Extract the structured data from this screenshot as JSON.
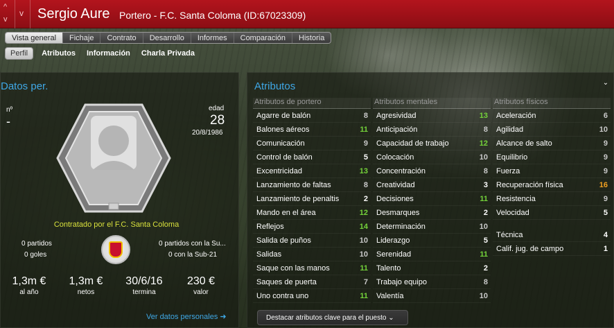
{
  "header": {
    "name": "Sergio Aure",
    "subtitle": "Portero - F.C. Santa Coloma (ID:67023309)",
    "up_icon": "^",
    "down_icon": "v",
    "dd_icon": "v"
  },
  "tabs": [
    "Vista general",
    "Fichaje",
    "Contrato",
    "Desarrollo",
    "Informes",
    "Comparación",
    "Historia"
  ],
  "subtabs": [
    "Perfil",
    "Atributos",
    "Información",
    "Charla Privada"
  ],
  "personal": {
    "title": "Datos per.",
    "num_label": "nº",
    "num_value": "-",
    "age_label": "edad",
    "age_value": "28",
    "dob": "20/8/1986",
    "contracted": "Contratado por el F.C. Santa Coloma",
    "partidos": "0 partidos",
    "goles": "0 goles",
    "sub_partidos": "0 partidos con la Su...",
    "sub_goles": "0 con la Sub-21",
    "money": [
      {
        "v": "1,3m €",
        "l": "al año"
      },
      {
        "v": "1,3m €",
        "l": "netos"
      },
      {
        "v": "30/6/16",
        "l": "termina"
      },
      {
        "v": "230 €",
        "l": "valor"
      }
    ],
    "link": "Ver datos personales ➜",
    "colors": {
      "accent": "#3fa8e6",
      "contract": "#d8e03c"
    }
  },
  "attributes": {
    "title": "Atributos",
    "columns": [
      {
        "header": "Atributos de portero",
        "rows": [
          {
            "n": "Agarre de balón",
            "v": "8"
          },
          {
            "n": "Balones aéreos",
            "v": "11"
          },
          {
            "n": "Comunicación",
            "v": "9"
          },
          {
            "n": "Control de balón",
            "v": "5"
          },
          {
            "n": "Excentricidad",
            "v": "13"
          },
          {
            "n": "Lanzamiento de faltas",
            "v": "8"
          },
          {
            "n": "Lanzamiento de penaltis",
            "v": "2"
          },
          {
            "n": "Mando en el área",
            "v": "12"
          },
          {
            "n": "Reflejos",
            "v": "14"
          },
          {
            "n": "Salida de puños",
            "v": "10"
          },
          {
            "n": "Salidas",
            "v": "10"
          },
          {
            "n": "Saque con las manos",
            "v": "11"
          },
          {
            "n": "Saques de puerta",
            "v": "7"
          },
          {
            "n": "Uno contra uno",
            "v": "11"
          }
        ]
      },
      {
        "header": "Atributos mentales",
        "rows": [
          {
            "n": "Agresividad",
            "v": "13"
          },
          {
            "n": "Anticipación",
            "v": "8"
          },
          {
            "n": "Capacidad de trabajo",
            "v": "12"
          },
          {
            "n": "Colocación",
            "v": "10"
          },
          {
            "n": "Concentración",
            "v": "8"
          },
          {
            "n": "Creatividad",
            "v": "3"
          },
          {
            "n": "Decisiones",
            "v": "11"
          },
          {
            "n": "Desmarques",
            "v": "2"
          },
          {
            "n": "Determinación",
            "v": "10"
          },
          {
            "n": "Liderazgo",
            "v": "5"
          },
          {
            "n": "Serenidad",
            "v": "11"
          },
          {
            "n": "Talento",
            "v": "2"
          },
          {
            "n": "Trabajo equipo",
            "v": "8"
          },
          {
            "n": "Valentía",
            "v": "10"
          }
        ]
      },
      {
        "header": "Atributos físicos",
        "rows": [
          {
            "n": "Aceleración",
            "v": "6"
          },
          {
            "n": "Agilidad",
            "v": "10"
          },
          {
            "n": "Alcance de salto",
            "v": "9"
          },
          {
            "n": "Equilibrio",
            "v": "9"
          },
          {
            "n": "Fuerza",
            "v": "9"
          },
          {
            "n": "Recuperación física",
            "v": "16"
          },
          {
            "n": "Resistencia",
            "v": "9"
          },
          {
            "n": "Velocidad",
            "v": "5"
          },
          {
            "n": "",
            "v": ""
          },
          {
            "n": "Técnica",
            "v": "4"
          },
          {
            "n": "Calif. jug. de campo",
            "v": "1"
          }
        ]
      }
    ],
    "highlight_button": "Destacar atributos clave para el puesto  ⌄",
    "expand_icon": "⌄"
  }
}
